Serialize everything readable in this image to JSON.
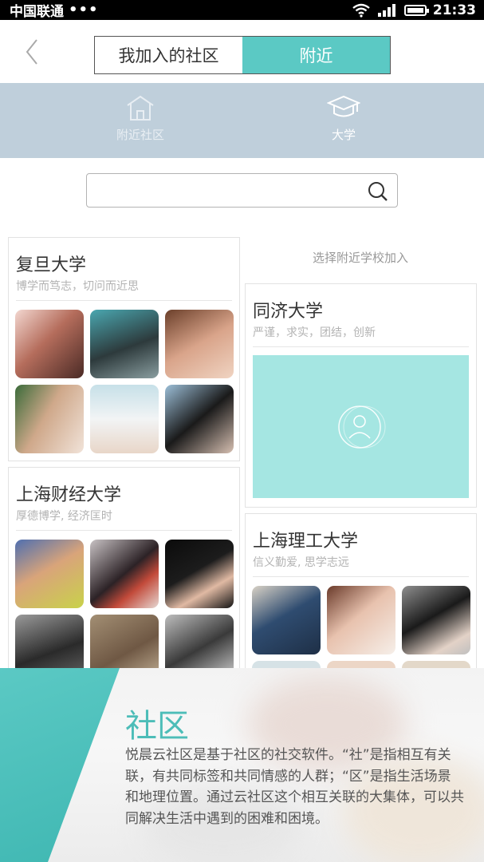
{
  "status_bar": {
    "carrier": "中国联通",
    "dots": "•••",
    "time": "21:33"
  },
  "header": {
    "tabs": [
      {
        "label": "我加入的社区",
        "active": false
      },
      {
        "label": "附近",
        "active": true
      }
    ]
  },
  "categories": [
    {
      "label": "附近社区",
      "icon": "house-icon"
    },
    {
      "label": "大学",
      "icon": "graduation-cap-icon"
    }
  ],
  "search": {
    "placeholder": ""
  },
  "hint": "选择附近学校加入",
  "universities": [
    {
      "name": "复旦大学",
      "motto": "博学而笃志，切问而近思"
    },
    {
      "name": "同济大学",
      "motto": "严谨，求实，团结，创新"
    },
    {
      "name": "上海财经大学",
      "motto": "厚德博学, 经济匡时"
    },
    {
      "name": "上海理工大学",
      "motto": "信义勤爱, 思学志远"
    }
  ],
  "overlay": {
    "title": "社区",
    "body": "悦晨云社区是基于社区的社交软件。“社”是指相互有关联，有共同标签和共同情感的人群；“区”是指生活场景和地理位置。通过云社区这个相互关联的大集体，可以共同解决生活中遇到的困难和困境。"
  },
  "colors": {
    "accent": "#5bc9c4",
    "category_bar": "#bfcfdb",
    "placeholder": "#a5e6e2"
  }
}
